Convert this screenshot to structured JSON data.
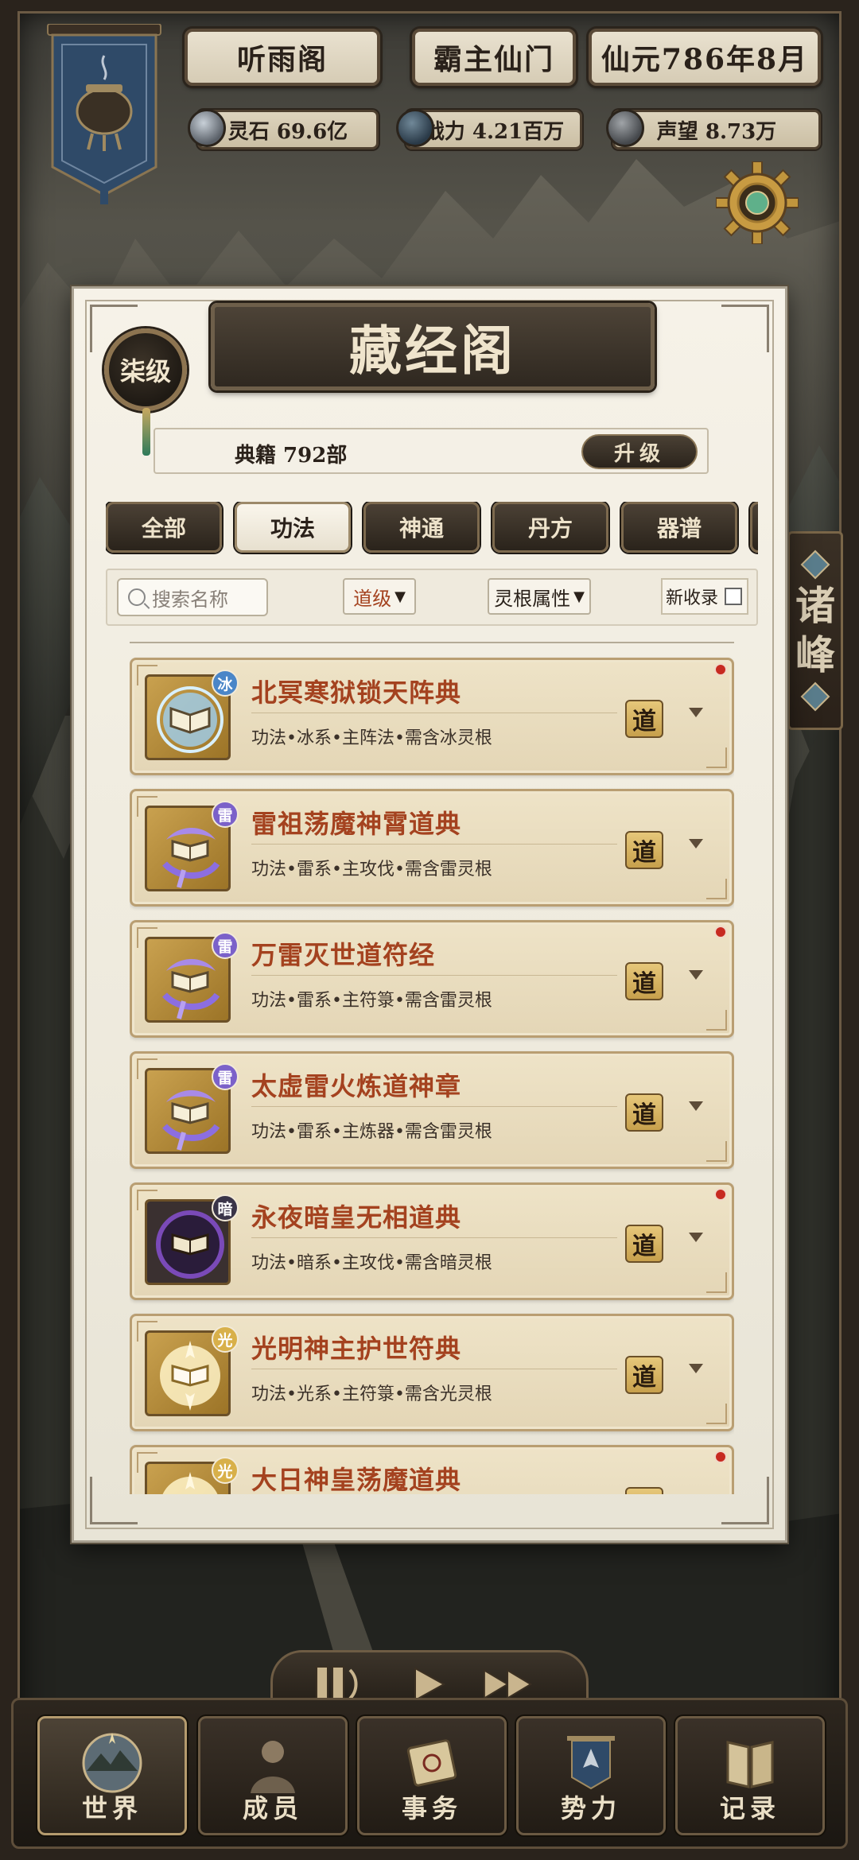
{
  "hud": {
    "sect_name": "听雨阁",
    "sect_rank": "霸主仙门",
    "date": "仙元786年8月",
    "resources": {
      "spirit_stone": "灵石 69.6亿",
      "power": "战力 4.21百万",
      "prestige": "声望 8.73万"
    }
  },
  "side_tab": {
    "chars": [
      "诸",
      "峰"
    ]
  },
  "panel": {
    "title": "藏经阁",
    "level": "柒级",
    "book_count": "典籍  792部",
    "upgrade_label": "升级",
    "tabs": [
      {
        "label": "全部",
        "active": false
      },
      {
        "label": "功法",
        "active": true
      },
      {
        "label": "神通",
        "active": false
      },
      {
        "label": "丹方",
        "active": false
      },
      {
        "label": "器谱",
        "active": false
      }
    ],
    "filters": {
      "search_placeholder": "搜索名称",
      "dao_level": "道级",
      "spirit_root": "灵根属性",
      "new_records": "新收录"
    },
    "items": [
      {
        "name": "北冥寒狱锁天阵典",
        "desc": "功法•冰系•主阵法•需含冰灵根",
        "element": "冰",
        "element_color": "#4a86c8",
        "grade": "道",
        "new": true,
        "icon": "ice-book-icon"
      },
      {
        "name": "雷祖荡魔神霄道典",
        "desc": "功法•雷系•主攻伐•需含雷灵根",
        "element": "雷",
        "element_color": "#7b61c9",
        "grade": "道",
        "new": false,
        "icon": "thunder-book-icon"
      },
      {
        "name": "万雷灭世道符经",
        "desc": "功法•雷系•主符箓•需含雷灵根",
        "element": "雷",
        "element_color": "#7b61c9",
        "grade": "道",
        "new": true,
        "icon": "thunder-book-icon"
      },
      {
        "name": "太虚雷火炼道神章",
        "desc": "功法•雷系•主炼器•需含雷灵根",
        "element": "雷",
        "element_color": "#7b61c9",
        "grade": "道",
        "new": false,
        "icon": "thunder-book-icon"
      },
      {
        "name": "永夜暗皇无相道典",
        "desc": "功法•暗系•主攻伐•需含暗灵根",
        "element": "暗",
        "element_color": "#3a3448",
        "grade": "道",
        "new": true,
        "icon": "dark-book-icon"
      },
      {
        "name": "光明神主护世符典",
        "desc": "功法•光系•主符箓•需含光灵根",
        "element": "光",
        "element_color": "#d8b04a",
        "grade": "道",
        "new": false,
        "icon": "light-book-icon"
      },
      {
        "name": "大日神皇荡魔道典",
        "desc": "",
        "element": "光",
        "element_color": "#d8b04a",
        "grade": "道",
        "new": true,
        "icon": "light-book-icon"
      }
    ]
  },
  "nav": [
    {
      "label": "世界",
      "icon": "world-icon",
      "active": true
    },
    {
      "label": "成员",
      "icon": "member-icon",
      "active": false
    },
    {
      "label": "事务",
      "icon": "scroll-icon",
      "active": false
    },
    {
      "label": "势力",
      "icon": "banner-icon",
      "active": false
    },
    {
      "label": "记录",
      "icon": "book-icon",
      "active": false
    }
  ],
  "speed_controls": [
    "pause-icon",
    "play-icon",
    "fast-forward-icon"
  ]
}
